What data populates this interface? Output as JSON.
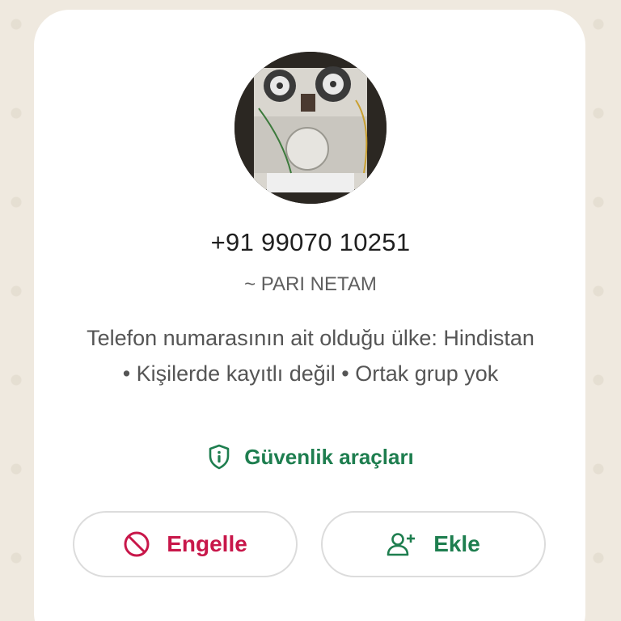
{
  "contact": {
    "phone": "+91 99070 10251",
    "push_name": "~ PARI NETAM",
    "info_text": "Telefon numarasının ait olduğu ülke: Hindistan • Kişilerde kayıtlı değil • Ortak grup yok"
  },
  "safety": {
    "label": "Güvenlik araçları",
    "icon": "shield-info-icon"
  },
  "actions": {
    "block_label": "Engelle",
    "block_icon": "block-icon",
    "add_label": "Ekle",
    "add_icon": "add-person-icon"
  },
  "colors": {
    "accent_green": "#1e7e4f",
    "danger_red": "#c8174a",
    "wallpaper": "#efe9df"
  }
}
